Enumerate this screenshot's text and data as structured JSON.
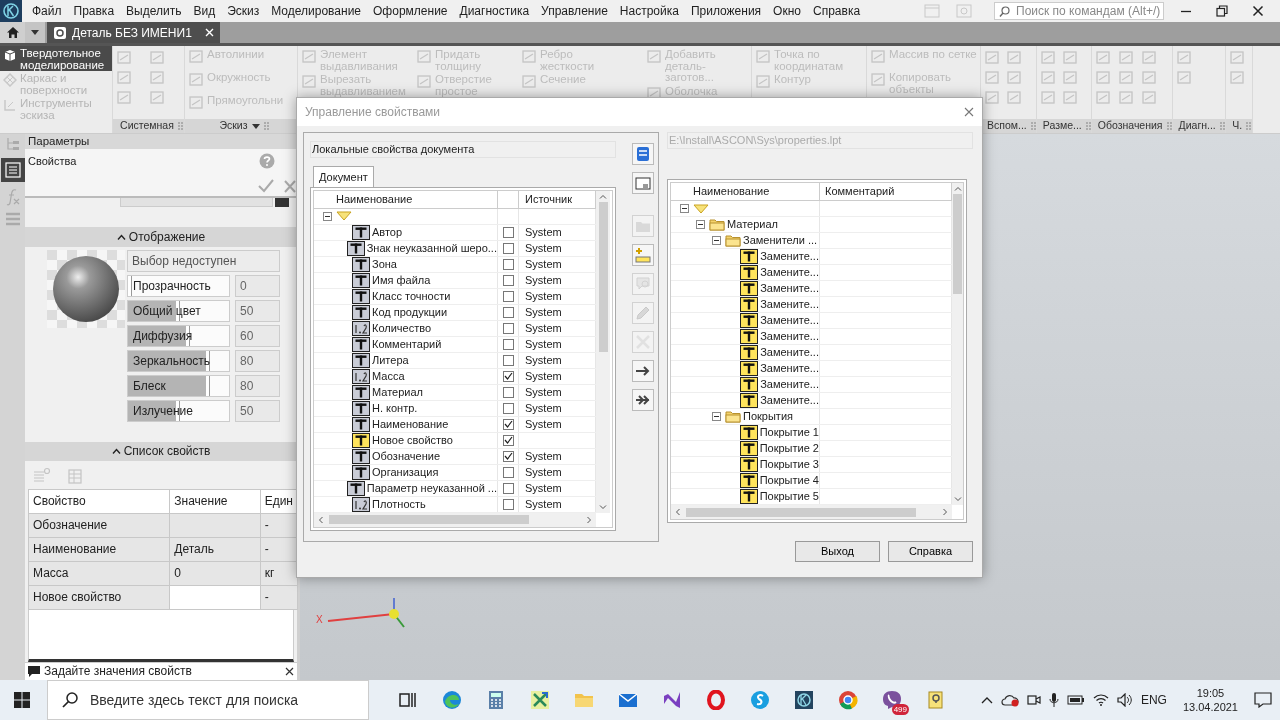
{
  "menu": [
    "Файл",
    "Правка",
    "Выделить",
    "Вид",
    "Эскиз",
    "Моделирование",
    "Оформление",
    "Диагностика",
    "Управление",
    "Настройка",
    "Приложения",
    "Окно",
    "Справка"
  ],
  "command_search": {
    "placeholder": "Поиск по командам (Alt+/)"
  },
  "document_tab": {
    "title": "Деталь БЕЗ ИМЕНИ1",
    "selected": true
  },
  "ribbon": {
    "modes": [
      {
        "label": "Твердотельное\nмоделирование",
        "selected": true
      },
      {
        "label": "Каркас и\nповерхности",
        "selected": false
      },
      {
        "label": "Инструменты\nэскиза",
        "selected": false
      }
    ],
    "groups": [
      {
        "kind": "icons",
        "label": "Системная"
      },
      {
        "kind": "commands",
        "label": "Эскиз",
        "columns": [
          [
            {
              "label": "Автолинии",
              "disabled": true
            },
            {
              "label": "Окружность",
              "disabled": true
            },
            {
              "label": "Прямоугольни",
              "disabled": true
            }
          ]
        ]
      },
      {
        "kind": "commands",
        "columns": [
          [
            {
              "label": "Элемент\nвыдавливания",
              "disabled": true
            },
            {
              "label": "Вырезать\nвыдавливанием",
              "disabled": true
            }
          ],
          [
            {
              "label": "Придать\nтолщину",
              "disabled": true
            },
            {
              "label": "Отверстие\nпростое",
              "disabled": true
            }
          ],
          [
            {
              "label": "Ребро\nжесткости",
              "disabled": true
            },
            {
              "label": "Сечение",
              "disabled": true
            }
          ],
          [
            {
              "label": "Добавить\nдеталь-заготов...",
              "disabled": true
            },
            {
              "label": "Оболочка",
              "disabled": true
            }
          ]
        ]
      },
      {
        "kind": "commands",
        "columns": [
          [
            {
              "label": "Точка по\nкоординатам",
              "disabled": true
            },
            {
              "label": "Контур",
              "disabled": true
            }
          ]
        ]
      },
      {
        "kind": "commands",
        "columns": [
          [
            {
              "label": "Массив по сетке",
              "disabled": true
            },
            {
              "label": "Копировать\nобъекты",
              "disabled": true
            }
          ]
        ]
      },
      {
        "kind": "icons",
        "label": "Вспом..."
      },
      {
        "kind": "icons",
        "label": "Разме..."
      },
      {
        "kind": "icons",
        "label": "Обозначения"
      },
      {
        "kind": "icons",
        "label": "Диагн..."
      },
      {
        "kind": "icons",
        "label": "Ч."
      }
    ]
  },
  "panel": {
    "title": "Параметры",
    "subtitle": "Свойства",
    "display": {
      "title": "Отображение",
      "expanded": true,
      "color_choice": "Выбор недоступен",
      "sliders": [
        {
          "label": "Прозрачность",
          "value": "0",
          "level": 0
        },
        {
          "label": "Общий цвет",
          "value": "50",
          "level": 0.5
        },
        {
          "label": "Диффузия",
          "value": "60",
          "level": 0.6
        },
        {
          "label": "Зеркальность",
          "value": "80",
          "level": 0.8
        },
        {
          "label": "Блеск",
          "value": "80",
          "level": 0.8
        },
        {
          "label": "Излучение",
          "value": "50",
          "level": 0.5
        }
      ]
    },
    "property_list": {
      "title": "Список свойств",
      "expanded": true,
      "columns": [
        "Свойство",
        "Значение",
        "Един"
      ],
      "rows": [
        {
          "property": "Обозначение",
          "unit": "-",
          "selected": false
        },
        {
          "property": "Наименование",
          "value": "Деталь",
          "unit": "-",
          "selected": false
        },
        {
          "property": "Масса",
          "value": "0",
          "unit": "кг",
          "selected": false
        },
        {
          "property": "Новое свойство",
          "unit": "-",
          "selected": true
        }
      ]
    }
  },
  "status": "Задайте значения свойств",
  "canvas": {
    "axis_label": "X"
  },
  "dialog": {
    "title": "Управление свойствами",
    "local_source": "Локальные свойства документа",
    "tabs": [
      {
        "label": "Документ",
        "selected": true
      }
    ],
    "left_tree": {
      "columns": [
        "Наименование",
        "Источник"
      ],
      "nodes": [
        {
          "kind": "root",
          "expanded": true,
          "children": [
            {
              "kind": "text",
              "name": "Автор",
              "checked": false,
              "source": "System"
            },
            {
              "kind": "text",
              "name": "Знак неуказанной шеро...",
              "checked": false,
              "source": "System"
            },
            {
              "kind": "text",
              "name": "Зона",
              "checked": false,
              "source": "System"
            },
            {
              "kind": "text",
              "name": "Имя файла",
              "checked": false,
              "source": "System"
            },
            {
              "kind": "text",
              "name": "Класс точности",
              "checked": false,
              "source": "System"
            },
            {
              "kind": "text",
              "name": "Код продукции",
              "checked": false,
              "source": "System"
            },
            {
              "kind": "number",
              "name": "Количество",
              "checked": false,
              "source": "System"
            },
            {
              "kind": "text",
              "name": "Комментарий",
              "checked": false,
              "source": "System"
            },
            {
              "kind": "text",
              "name": "Литера",
              "checked": false,
              "source": "System"
            },
            {
              "kind": "number",
              "name": "Масса",
              "checked": true,
              "source": "System"
            },
            {
              "kind": "text",
              "name": "Материал",
              "checked": false,
              "source": "System"
            },
            {
              "kind": "text",
              "name": "Н. контр.",
              "checked": false,
              "source": "System"
            },
            {
              "kind": "text",
              "name": "Наименование",
              "checked": true,
              "source": "System"
            },
            {
              "kind": "user",
              "name": "Новое свойство",
              "checked": true
            },
            {
              "kind": "text",
              "name": "Обозначение",
              "checked": true,
              "source": "System"
            },
            {
              "kind": "text",
              "name": "Организация",
              "checked": false,
              "source": "System"
            },
            {
              "kind": "text",
              "name": "Параметр неуказанной ...",
              "checked": false,
              "source": "System"
            },
            {
              "kind": "number",
              "name": "Плотность",
              "checked": false,
              "source": "System"
            }
          ]
        }
      ]
    },
    "tool_buttons": [
      {
        "kind": "database",
        "disabled": false
      },
      {
        "kind": "form",
        "disabled": false
      },
      {
        "kind": "folder",
        "disabled": true
      },
      {
        "kind": "add",
        "disabled": false
      },
      {
        "kind": "comment",
        "disabled": true
      },
      {
        "kind": "edit",
        "disabled": true
      },
      {
        "kind": "delete",
        "disabled": true
      },
      {
        "kind": "move",
        "disabled": false
      },
      {
        "kind": "moveall",
        "disabled": false
      }
    ],
    "library_path": {
      "value": "E:\\Install\\ASCON\\Sys\\properties.lpt",
      "disabled": true
    },
    "right_tree": {
      "columns": [
        "Наименование",
        "Комментарий"
      ],
      "nodes": [
        {
          "kind": "root",
          "expanded": true,
          "children": [
            {
              "kind": "folder",
              "name": "Материал",
              "expanded": true,
              "children": [
                {
                  "kind": "folder",
                  "name": "Заменители ...",
                  "expanded": true,
                  "children": [
                    {
                      "kind": "user",
                      "name": "Замените..."
                    },
                    {
                      "kind": "user",
                      "name": "Замените..."
                    },
                    {
                      "kind": "user",
                      "name": "Замените..."
                    },
                    {
                      "kind": "user",
                      "name": "Замените..."
                    },
                    {
                      "kind": "user",
                      "name": "Замените..."
                    },
                    {
                      "kind": "user",
                      "name": "Замените..."
                    },
                    {
                      "kind": "user",
                      "name": "Замените..."
                    },
                    {
                      "kind": "user",
                      "name": "Замените..."
                    },
                    {
                      "kind": "user",
                      "name": "Замените..."
                    },
                    {
                      "kind": "user",
                      "name": "Замените..."
                    }
                  ]
                },
                {
                  "kind": "folder",
                  "name": "Покрытия",
                  "expanded": true,
                  "children": [
                    {
                      "kind": "user",
                      "name": "Покрытие 1"
                    },
                    {
                      "kind": "user",
                      "name": "Покрытие 2"
                    },
                    {
                      "kind": "user",
                      "name": "Покрытие 3"
                    },
                    {
                      "kind": "user",
                      "name": "Покрытие 4"
                    },
                    {
                      "kind": "user",
                      "name": "Покрытие 5"
                    }
                  ]
                }
              ]
            }
          ]
        }
      ]
    },
    "buttons": [
      "Выход",
      "Справка"
    ]
  },
  "taskbar": {
    "search": {
      "placeholder": "Введите здесь текст для поиска"
    },
    "apps": [
      {
        "kind": "taskview"
      },
      {
        "kind": "browser"
      },
      {
        "kind": "calculator"
      },
      {
        "kind": "crossapp"
      },
      {
        "kind": "folder"
      },
      {
        "kind": "mail"
      },
      {
        "kind": "ribbonlogo"
      },
      {
        "kind": "ring"
      },
      {
        "kind": "bluecircle"
      },
      {
        "kind": "cad"
      },
      {
        "kind": "wheel"
      },
      {
        "kind": "phone",
        "badge": "499"
      },
      {
        "kind": "helpfile"
      }
    ],
    "language": "ENG",
    "time": "19:05",
    "date": "13.04.2021"
  }
}
